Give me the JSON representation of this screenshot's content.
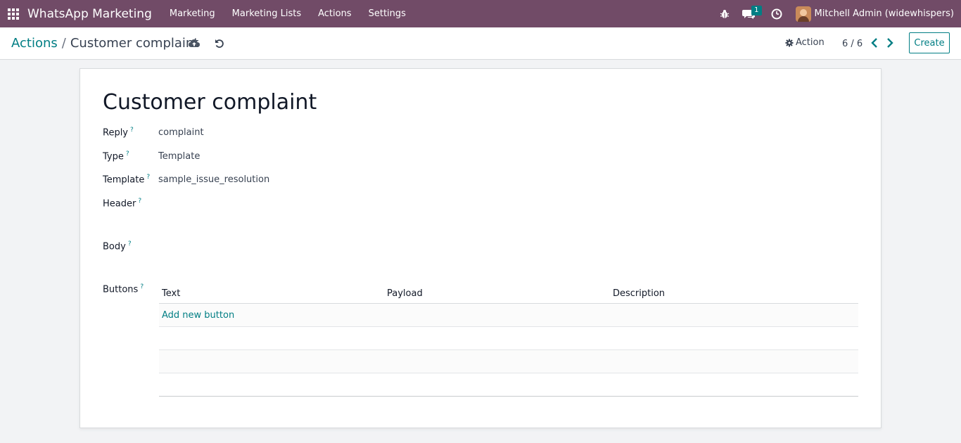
{
  "navbar": {
    "app_name": "WhatsApp Marketing",
    "menu": [
      "Marketing",
      "Marketing Lists",
      "Actions",
      "Settings"
    ],
    "chat_badge": "1",
    "user": "Mitchell Admin (widewhispers)",
    "bg_color": "#714b67"
  },
  "breadcrumb": {
    "parent": "Actions",
    "separator": "/",
    "current": "Customer complaint"
  },
  "control": {
    "action_label": "Action",
    "pager": "6 / 6",
    "create_label": "Create"
  },
  "form": {
    "title": "Customer complaint",
    "fields": {
      "reply_label": "Reply",
      "reply_value": "complaint",
      "type_label": "Type",
      "type_value": "Template",
      "template_label": "Template",
      "template_value": "sample_issue_resolution",
      "header_label": "Header",
      "body_label": "Body",
      "buttons_label": "Buttons",
      "help_mark": "?"
    },
    "buttons_table": {
      "columns": [
        "Text",
        "Payload",
        "Description"
      ],
      "add_link": "Add new button"
    }
  },
  "colors": {
    "accent": "#017e84",
    "brand": "#714b67"
  }
}
